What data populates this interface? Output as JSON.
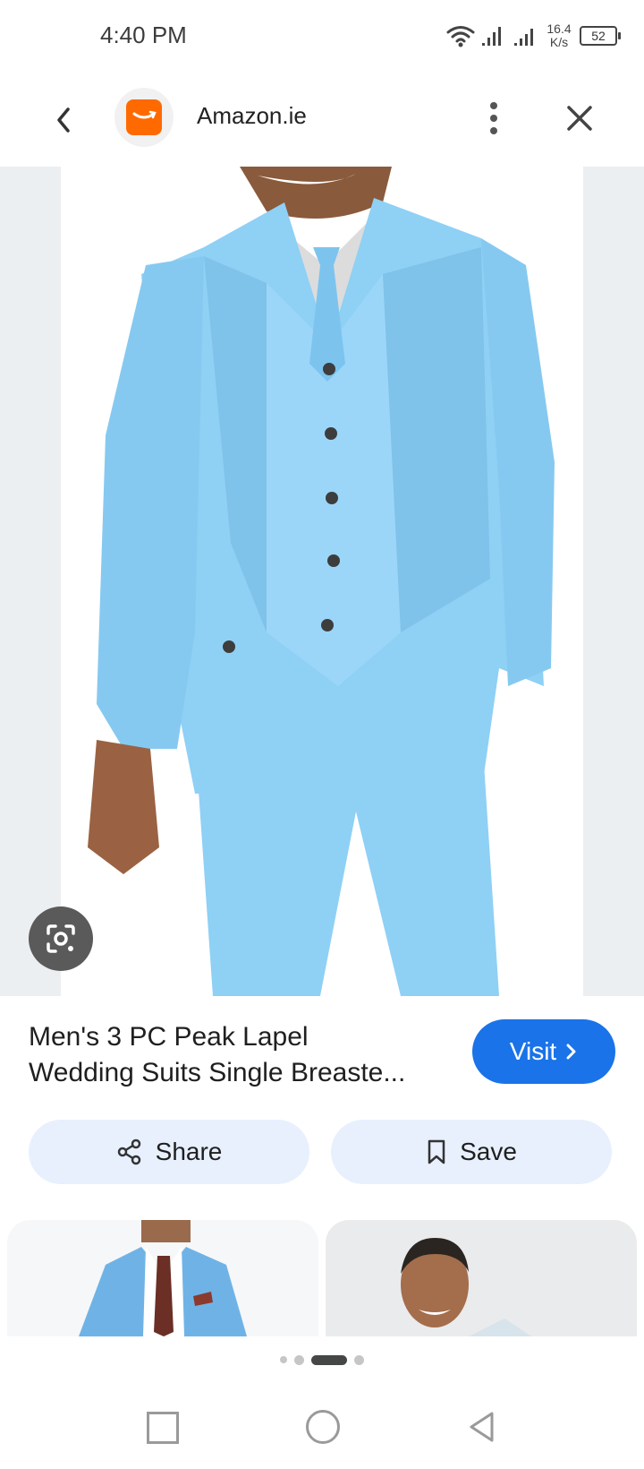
{
  "status_bar": {
    "time": "4:40 PM",
    "speed_value": "16.4",
    "speed_unit": "K/s",
    "battery": "52"
  },
  "header": {
    "site_name": "Amazon.ie",
    "icons": [
      "back-icon",
      "amazon-logo-icon",
      "more-vert-icon",
      "close-icon"
    ]
  },
  "product": {
    "title_line1": "Men's 3 PC Peak Lapel",
    "title_line2": "Wedding Suits Single Breaste...",
    "visit_label": "Visit"
  },
  "actions": {
    "share_label": "Share",
    "save_label": "Save"
  },
  "pagination": {
    "dots": 5,
    "active_index": 2
  },
  "colors": {
    "accent": "#1a73e8",
    "pill_bg": "#e8f0fe",
    "suit": "#8fd0f5",
    "amazon_orange": "#ff6a00"
  }
}
